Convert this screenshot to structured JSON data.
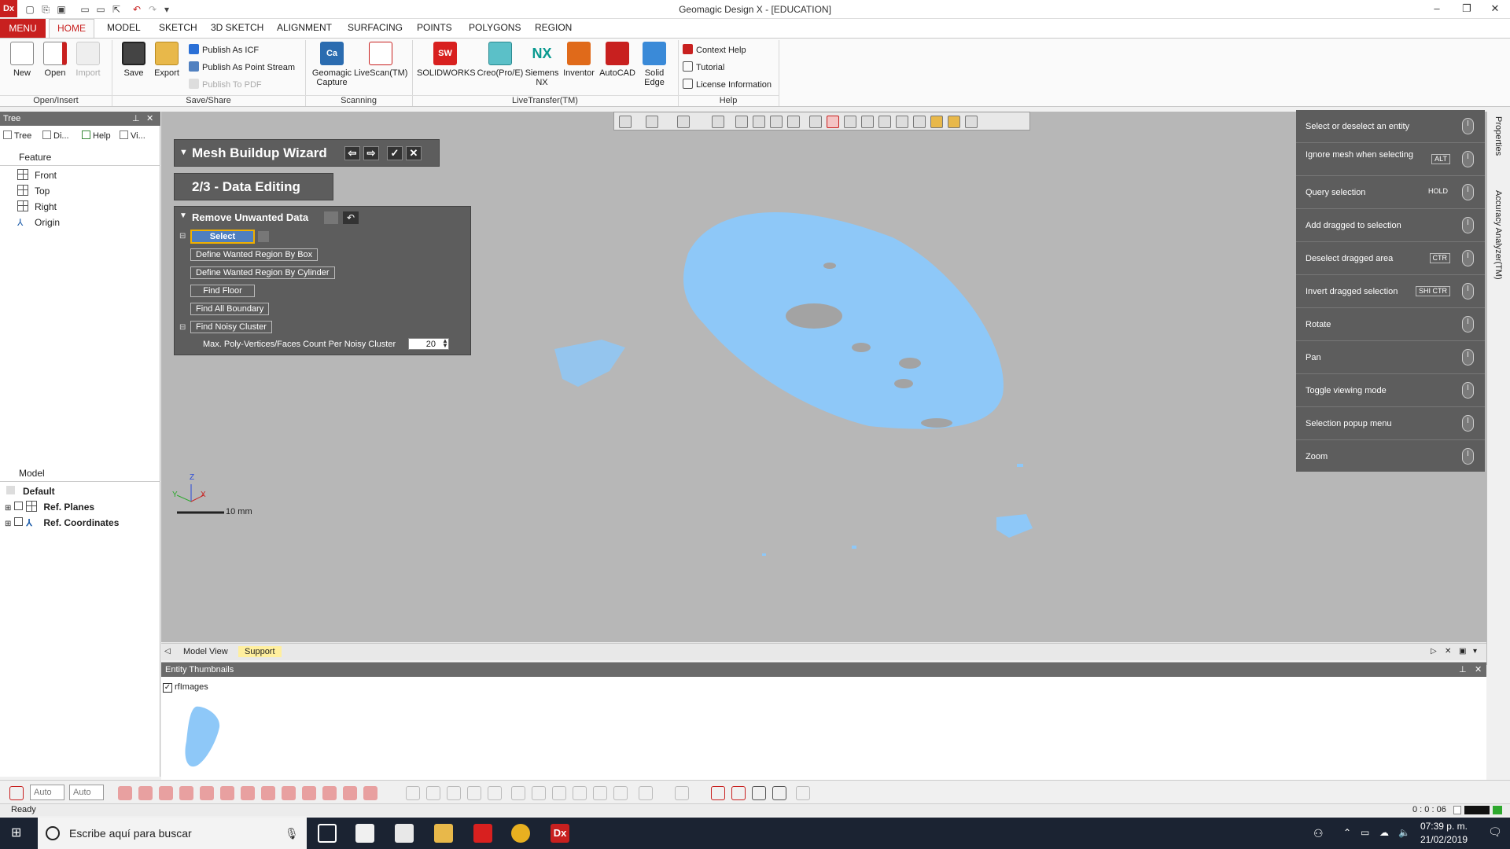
{
  "window": {
    "title": "Geomagic Design X - [EDUCATION]",
    "app_logo": "Dx"
  },
  "menu_tabs": [
    "MENU",
    "HOME",
    "MODEL",
    "SKETCH",
    "3D SKETCH",
    "ALIGNMENT",
    "SURFACING",
    "POINTS",
    "POLYGONS",
    "REGION"
  ],
  "ribbon": {
    "open_insert": {
      "new": "New",
      "open": "Open",
      "import": "Import",
      "group": "Open/Insert"
    },
    "save_share": {
      "save": "Save",
      "export": "Export",
      "publish_icf": "Publish As ICF",
      "publish_point_stream": "Publish As Point Stream",
      "publish_pdf": "Publish To PDF",
      "group": "Save/Share"
    },
    "scanning": {
      "geomagic_capture_1": "Geomagic",
      "geomagic_capture_2": "Capture",
      "livescan": "LiveScan(TM)",
      "group": "Scanning"
    },
    "livetransfer": {
      "solidworks": "SOLIDWORKS",
      "creo": "Creo(Pro/E)",
      "siemens_nx_1": "Siemens",
      "siemens_nx_2": "NX",
      "inventor": "Inventor",
      "autocad": "AutoCAD",
      "solid_edge_1": "Solid",
      "solid_edge_2": "Edge",
      "group": "LiveTransfer(TM)"
    },
    "help": {
      "context_help": "Context Help",
      "tutorial": "Tutorial",
      "license": "License Information",
      "group": "Help"
    }
  },
  "left_panel": {
    "header": "Tree",
    "tabs": [
      "Tree",
      "Di...",
      "Help",
      "Vi..."
    ],
    "feature_label": "Feature",
    "features": [
      "Front",
      "Top",
      "Right",
      "Origin"
    ],
    "model_label": "Model",
    "model_items": [
      "Default",
      "Ref. Planes",
      "Ref. Coordinates"
    ]
  },
  "wizard": {
    "title": "Mesh Buildup Wizard",
    "step": "2/3 - Data Editing",
    "section": "Remove Unwanted Data",
    "options": [
      "Select",
      "Define Wanted Region By Box",
      "Define Wanted Region By Cylinder",
      "Find Floor",
      "Find All Boundary",
      "Find Noisy Cluster"
    ],
    "noisy_label": "Max. Poly-Vertices/Faces Count Per Noisy Cluster",
    "noisy_value": "20"
  },
  "mouse_guide": [
    {
      "text": "Select or deselect an entity",
      "key": ""
    },
    {
      "text": "Ignore mesh when selecting",
      "key": "ALT"
    },
    {
      "text": "Query selection",
      "key": "HOLD"
    },
    {
      "text": "Add dragged to selection",
      "key": ""
    },
    {
      "text": "Deselect dragged area",
      "key": "CTR"
    },
    {
      "text": "Invert dragged selection",
      "key": "SHI CTR"
    },
    {
      "text": "Rotate",
      "key": ""
    },
    {
      "text": "Pan",
      "key": ""
    },
    {
      "text": "Toggle viewing mode",
      "key": ""
    },
    {
      "text": "Selection popup menu",
      "key": ""
    },
    {
      "text": "Zoom",
      "key": ""
    }
  ],
  "right_dock": {
    "properties": "Properties",
    "accuracy": "Accuracy Analyzer(TM)"
  },
  "viewport": {
    "scale_label": "10 mm",
    "axis_x": "X",
    "axis_y": "Y",
    "axis_z": "Z"
  },
  "view_tabs": {
    "model_view": "Model View",
    "support": "Support"
  },
  "thumbnails": {
    "header": "Entity Thumbnails",
    "item": "rfImages",
    "checked": true
  },
  "bottom_toolbar": {
    "select1": "Auto",
    "select2": "Auto"
  },
  "status": {
    "left": "Ready",
    "right": "0 : 0 : 06"
  },
  "taskbar": {
    "search_placeholder": "Escribe aquí para buscar",
    "time": "07:39 p. m.",
    "date": "21/02/2019"
  },
  "colors": {
    "accent_red": "#c8201f",
    "viewport_bg": "#b7b7b7",
    "mesh_blue": "#8ec8f8",
    "panel_dark": "#5d5d5d"
  }
}
